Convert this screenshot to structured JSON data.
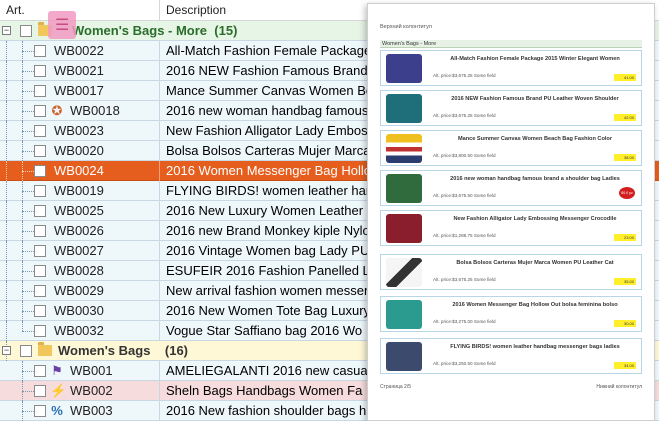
{
  "header": {
    "col_art": "Art.",
    "col_description": "Description"
  },
  "groups": [
    {
      "title": "Women's Bags - More",
      "count": "(15)"
    },
    {
      "title": "Women's Bags",
      "count": "(16)"
    }
  ],
  "rows": [
    {
      "code": "WB0022",
      "desc": "All-Match Fashion Female Package 2015 Winter Elegant Women"
    },
    {
      "code": "WB0021",
      "desc": "2016 NEW Fashion Famous Brand PU Leather Woven Shoulder"
    },
    {
      "code": "WB0017",
      "desc": "Mance Summer Canvas Women Beach Bag Fashion Color"
    },
    {
      "code": "WB0018",
      "desc": "2016 new woman handbag famous brand a shoulder bag Ladies"
    },
    {
      "code": "WB0023",
      "desc": "New Fashion Alligator Lady Embossing Messenger Crocodile"
    },
    {
      "code": "WB0020",
      "desc": "Bolsa Bolsos Carteras Mujer Marca Women PU Leather Cat"
    },
    {
      "code": "WB0024",
      "desc": "2016 Women Messenger Bag Hollow Out bolsa feminina bolso"
    },
    {
      "code": "WB0019",
      "desc": "FLYING BIRDS! women leather handbag messenger bags ladies"
    },
    {
      "code": "WB0025",
      "desc": "2016 New Luxury Women Leather"
    },
    {
      "code": "WB0026",
      "desc": "2016 new Brand Monkey kiple Nylo"
    },
    {
      "code": "WB0027",
      "desc": "2016 Vintage Women bag Lady PU"
    },
    {
      "code": "WB0028",
      "desc": "ESUFEIR 2016 Fashion Panelled L"
    },
    {
      "code": "WB0029",
      "desc": "New arrival fashion women messen"
    },
    {
      "code": "WB0030",
      "desc": "2016 New Women Tote Bag Luxury"
    },
    {
      "code": "WB0032",
      "desc": "Vogue Star Saffiano bag 2016 Wo"
    }
  ],
  "rows2": [
    {
      "code": "WB001",
      "desc": "AMELIEGALANTI 2016 new casual"
    },
    {
      "code": "WB002",
      "desc": "Sheln Bags Handbags Women Fa"
    },
    {
      "code": "WB003",
      "desc": "2016 New fashion shoulder bags h"
    }
  ],
  "preview": {
    "header_text": "Верхний колонтитул",
    "section_title": "Women's Bags - More",
    "price_text": "Alt. price:$3,675.25 Some field",
    "footer_left": "Страница 2/5",
    "footer_right": "Нижний колонтитул",
    "cards": [
      {
        "title": "All-Match Fashion Female Package 2015 Winter Elegant Women",
        "price": "Alt. price:$3,675.25 Some field",
        "tag": "41.00",
        "color": "#3b3f8c"
      },
      {
        "title": "2016 NEW Fashion Famous Brand PU Leather Woven Shoulder",
        "price": "Alt. price:$3,675.25 Some field",
        "tag": "42.00",
        "color": "#1e6f7a"
      },
      {
        "title": "Mance Summer Canvas Women Beach Bag Fashion Color",
        "price": "Alt. price:$3,800.50 Some field",
        "tag": "38.00",
        "color": "#c0312f"
      },
      {
        "title": "2016 new woman handbag famous brand a shoulder bag Ladies",
        "price": "Alt. price:$3,675.50 Some field",
        "tag": "60.00",
        "color": "#2f6b3d"
      },
      {
        "title": "New Fashion Alligator Lady Embossing Messenger Crocodile",
        "price": "Alt. price:$1,288.75 Some field",
        "tag": "23.00",
        "color": "#8a1e2c"
      },
      {
        "title": "Bolsa Bolsos Carteras Mujer Marca Women PU Leather Cat",
        "price": "Alt. price:$3,675.25 Some field",
        "tag": "35.00",
        "color": "#444444"
      },
      {
        "title": "2016 Women Messenger Bag Hollow Out bolsa feminina bolso",
        "price": "Alt. price:$3,275.00 Some field",
        "tag": "30.00",
        "color": "#2b9a8f"
      },
      {
        "title": "FLYING BIRDS! women leather handbag messenger bags ladies",
        "price": "Alt. price:$3,250.50 Some field",
        "tag": "34.00",
        "color": "#3c4a6e"
      }
    ],
    "red_badge": "80.0 pz"
  }
}
